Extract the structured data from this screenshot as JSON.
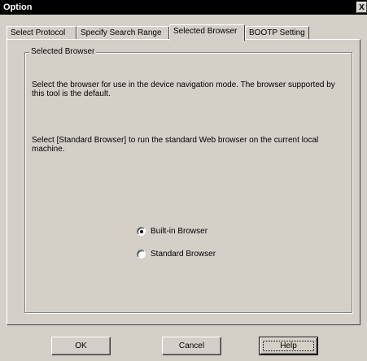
{
  "window": {
    "title": "Option",
    "close_glyph": "X"
  },
  "tabs": [
    {
      "label": "Select Protocol",
      "active": false
    },
    {
      "label": "Specify Search Range",
      "active": false
    },
    {
      "label": "Selected Browser",
      "active": true
    },
    {
      "label": "BOOTP Setting",
      "active": false
    }
  ],
  "group": {
    "legend": "Selected Browser",
    "description_1": "Select the browser for use in the device navigation mode. The browser supported by this tool is the default.",
    "description_2": "Select [Standard Browser] to run the standard Web browser on the current local machine."
  },
  "radios": [
    {
      "label": "Built-in Browser",
      "checked": true
    },
    {
      "label": "Standard Browser",
      "checked": false
    }
  ],
  "buttons": {
    "ok": "OK",
    "cancel": "Cancel",
    "help": "Help"
  },
  "colors": {
    "face": "#d4d0c8",
    "titlebar": "#000000",
    "title_text": "#ffffff"
  }
}
